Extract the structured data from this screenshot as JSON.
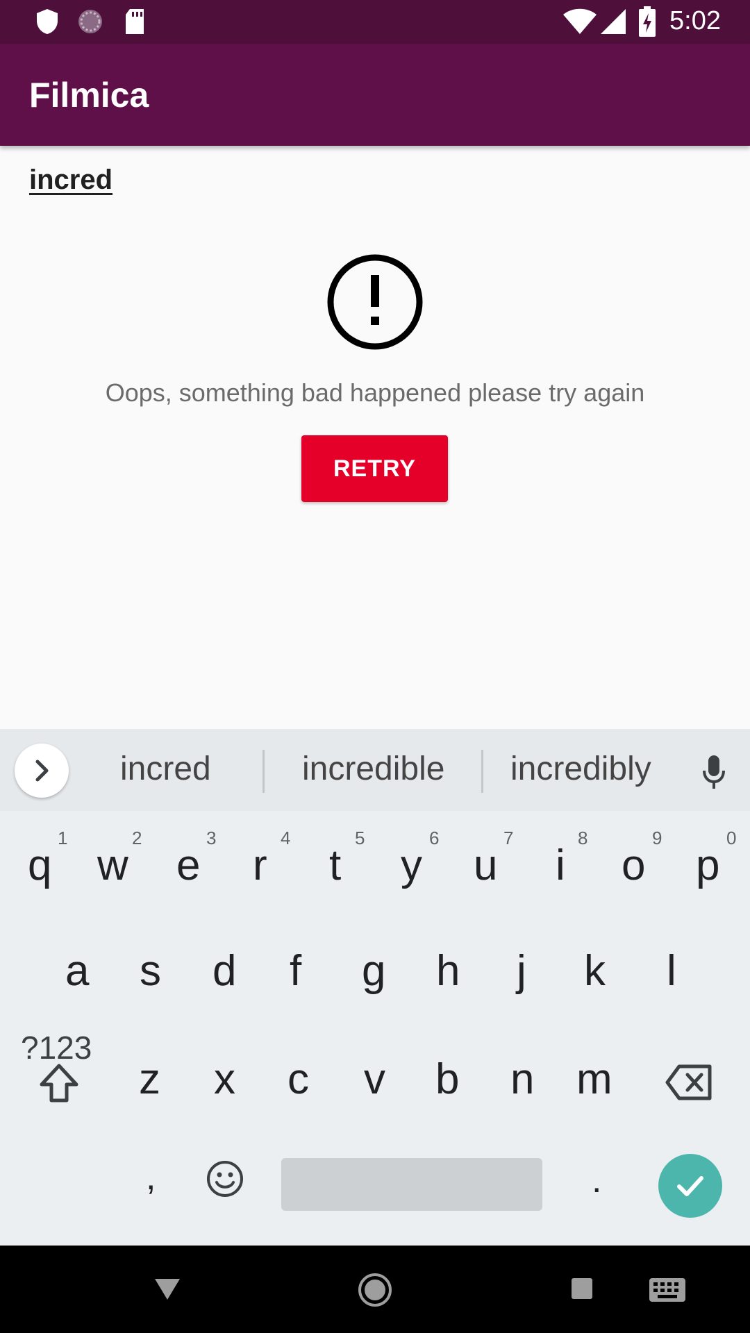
{
  "status_bar": {
    "time": "5:02"
  },
  "app_bar": {
    "title": "Filmica"
  },
  "search": {
    "query": "incred"
  },
  "error": {
    "message": "Oops, something bad happened please try again",
    "retry_label": "RETRY"
  },
  "colors": {
    "status_bar": "#4e0f3b",
    "app_bar": "#5f1048",
    "retry_button": "#e5002a",
    "enter_key": "#4db6ac"
  },
  "keyboard": {
    "suggestions": [
      "incred",
      "incredible",
      "incredibly"
    ],
    "row1": [
      {
        "key": "q",
        "hint": "1"
      },
      {
        "key": "w",
        "hint": "2"
      },
      {
        "key": "e",
        "hint": "3"
      },
      {
        "key": "r",
        "hint": "4"
      },
      {
        "key": "t",
        "hint": "5"
      },
      {
        "key": "y",
        "hint": "6"
      },
      {
        "key": "u",
        "hint": "7"
      },
      {
        "key": "i",
        "hint": "8"
      },
      {
        "key": "o",
        "hint": "9"
      },
      {
        "key": "p",
        "hint": "0"
      }
    ],
    "row2": [
      "a",
      "s",
      "d",
      "f",
      "g",
      "h",
      "j",
      "k",
      "l"
    ],
    "row3": [
      "z",
      "x",
      "c",
      "v",
      "b",
      "n",
      "m"
    ],
    "symbols_label": "?123",
    "comma": ",",
    "period": "."
  }
}
